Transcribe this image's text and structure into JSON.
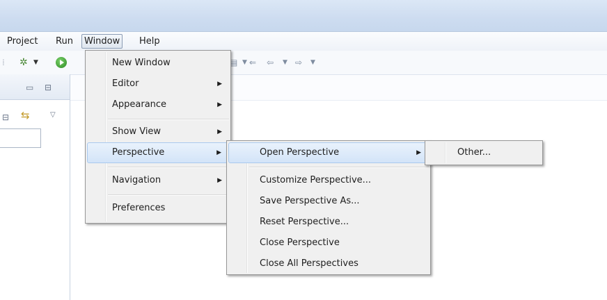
{
  "menubar": {
    "items": [
      {
        "label": "Project"
      },
      {
        "label": "Run"
      },
      {
        "label": "Window"
      },
      {
        "label": "Help"
      }
    ]
  },
  "toolbar": {
    "icons": [
      "debug-icon",
      "dropdown-arrow-icon",
      "run-icon",
      "dropdown-arrow-icon",
      "annotation-icon",
      "previous-edit-icon",
      "back-icon",
      "forward-icon"
    ]
  },
  "window_menu": {
    "items": [
      {
        "label": "New Window",
        "submenu": false
      },
      {
        "label": "Editor",
        "submenu": true
      },
      {
        "label": "Appearance",
        "submenu": true
      },
      {
        "label": "Show View",
        "submenu": true
      },
      {
        "label": "Perspective",
        "submenu": true,
        "highlighted": true
      },
      {
        "label": "Navigation",
        "submenu": true
      },
      {
        "label": "Preferences",
        "submenu": false
      }
    ]
  },
  "perspective_menu": {
    "items": [
      {
        "label": "Open Perspective",
        "submenu": true,
        "highlighted": true
      },
      {
        "label": "Customize Perspective..."
      },
      {
        "label": "Save Perspective As..."
      },
      {
        "label": "Reset Perspective..."
      },
      {
        "label": "Close Perspective"
      },
      {
        "label": "Close All Perspectives"
      }
    ]
  },
  "open_perspective_menu": {
    "items": [
      {
        "label": "Other..."
      }
    ]
  },
  "colors": {
    "highlight_top": "#e9f2fc",
    "highlight_bottom": "#d3e4f8",
    "highlight_border": "#a9c9ee",
    "menu_bg": "#f0f0f0"
  }
}
